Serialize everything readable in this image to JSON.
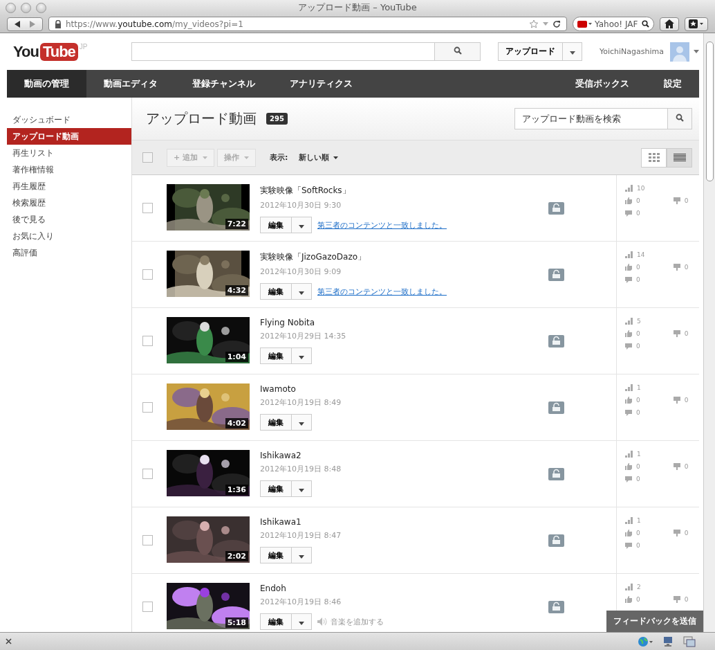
{
  "window": {
    "title": "アップロード動画 – YouTube"
  },
  "address_bar": {
    "prefix": "https://www.",
    "domain": "youtube.com",
    "path": "/my_videos?pi=1"
  },
  "search_engine": {
    "value": "Yahoo! JAF"
  },
  "logo": {
    "you": "You",
    "tube": "Tube",
    "region": "JP"
  },
  "upload_button": "アップロード",
  "user": {
    "name": "YoichiNagashima"
  },
  "nav_tabs": [
    {
      "label": "動画の管理",
      "selected": true
    },
    {
      "label": "動画エディタ",
      "selected": false
    },
    {
      "label": "登録チャンネル",
      "selected": false
    },
    {
      "label": "アナリティクス",
      "selected": false
    }
  ],
  "nav_right": [
    "受信ボックス",
    "設定"
  ],
  "sidebar": {
    "items": [
      {
        "label": "ダッシュボード",
        "selected": false
      },
      {
        "label": "アップロード動画",
        "selected": true
      },
      {
        "label": "再生リスト",
        "selected": false
      },
      {
        "label": "著作権情報",
        "selected": false
      },
      {
        "label": "再生履歴",
        "selected": false
      },
      {
        "label": "検索履歴",
        "selected": false
      },
      {
        "label": "後で見る",
        "selected": false
      },
      {
        "label": "お気に入り",
        "selected": false
      },
      {
        "label": "高評価",
        "selected": false
      }
    ]
  },
  "heading": {
    "title": "アップロード動画",
    "count": "295"
  },
  "video_search": {
    "placeholder": "アップロード動画を検索"
  },
  "toolbar": {
    "select_all_checked": false,
    "add": {
      "label": "+ 追加",
      "disabled": true
    },
    "actions": {
      "label": "操作",
      "disabled": true
    },
    "sort_label": "表示:",
    "sort_value": "新しい順",
    "view_buttons": [
      {
        "kind": "grid",
        "selected": false
      },
      {
        "kind": "list",
        "selected": true
      }
    ]
  },
  "videos": [
    {
      "title": "実験映像「SoftRocks」",
      "date": "2012年10月30日 9:30",
      "duration": "7:22",
      "checked": false,
      "edit": "編集",
      "extra": {
        "kind": "link",
        "text": "第三者のコンテンツと一致しました。"
      },
      "views": "10",
      "likes": "0",
      "dislikes": "0",
      "comments": "0"
    },
    {
      "title": "実験映像「JizoGazoDazo」",
      "date": "2012年10月30日 9:09",
      "duration": "4:32",
      "checked": false,
      "edit": "編集",
      "extra": {
        "kind": "link",
        "text": "第三者のコンテンツと一致しました。"
      },
      "views": "14",
      "likes": "0",
      "dislikes": "0",
      "comments": "0"
    },
    {
      "title": "Flying Nobita",
      "date": "2012年10月29日 14:35",
      "duration": "1:04",
      "checked": false,
      "edit": "編集",
      "views": "5",
      "likes": "0",
      "dislikes": "0",
      "comments": "0"
    },
    {
      "title": "Iwamoto",
      "date": "2012年10月19日 8:49",
      "duration": "4:02",
      "checked": false,
      "edit": "編集",
      "views": "1",
      "likes": "0",
      "dislikes": "0",
      "comments": "0"
    },
    {
      "title": "Ishikawa2",
      "date": "2012年10月19日 8:48",
      "duration": "1:36",
      "checked": false,
      "edit": "編集",
      "views": "1",
      "likes": "0",
      "dislikes": "0",
      "comments": "0"
    },
    {
      "title": "Ishikawa1",
      "date": "2012年10月19日 8:47",
      "duration": "2:02",
      "checked": false,
      "edit": "編集",
      "views": "1",
      "likes": "0",
      "dislikes": "0",
      "comments": "0"
    },
    {
      "title": "Endoh",
      "date": "2012年10月19日 8:46",
      "duration": "5:18",
      "checked": false,
      "edit": "編集",
      "extra": {
        "kind": "music",
        "text": "音楽を追加する"
      },
      "views": "2",
      "likes": "0",
      "dislikes": "0"
    }
  ],
  "feedback_button": "フィードバックを送信"
}
